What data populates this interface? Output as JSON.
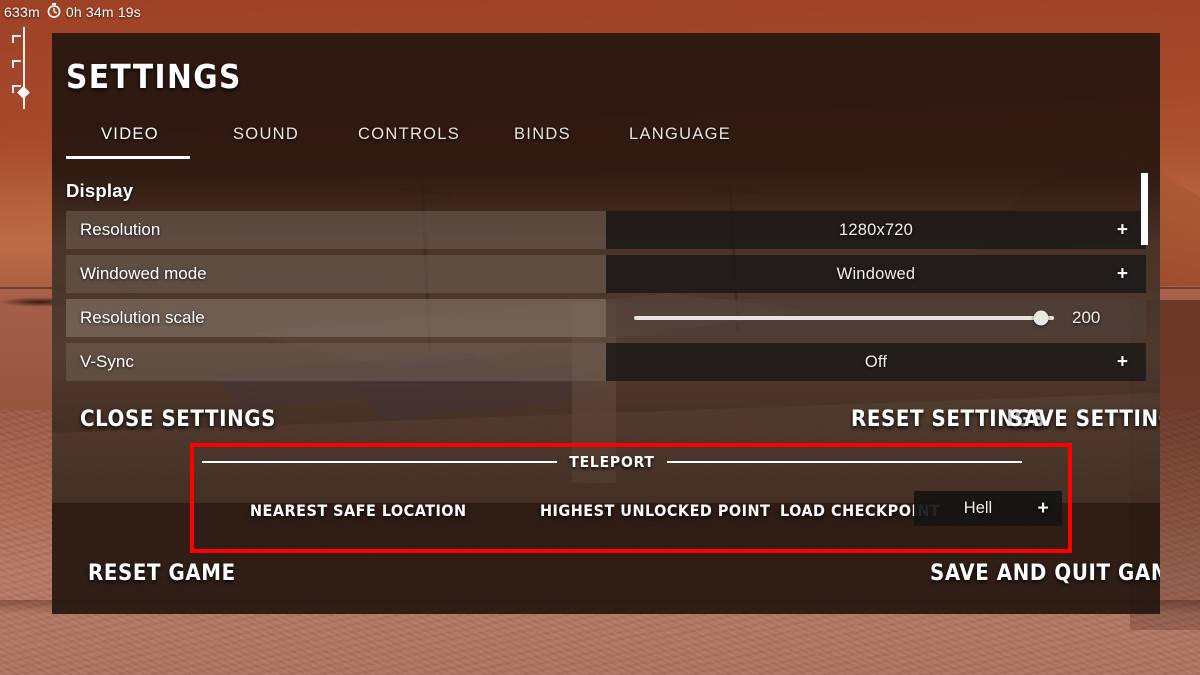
{
  "hud": {
    "distance": "633m",
    "timer_icon": "stopwatch-icon",
    "time": "0h 34m 19s"
  },
  "panel": {
    "title": "SETTINGS"
  },
  "tabs": [
    {
      "label": "VIDEO",
      "active": true
    },
    {
      "label": "SOUND",
      "active": false
    },
    {
      "label": "CONTROLS",
      "active": false
    },
    {
      "label": "BINDS",
      "active": false
    },
    {
      "label": "LANGUAGE",
      "active": false
    }
  ],
  "section": {
    "heading": "Display",
    "rows": [
      {
        "label": "Resolution",
        "type": "dropdown",
        "value": "1280x720",
        "increment": "+"
      },
      {
        "label": "Windowed mode",
        "type": "dropdown",
        "value": "Windowed",
        "increment": "+"
      },
      {
        "label": "Resolution scale",
        "type": "slider",
        "value": "200",
        "min": 0,
        "max": 200,
        "percent": 97
      },
      {
        "label": "V-Sync",
        "type": "dropdown",
        "value": "Off",
        "increment": "+"
      }
    ]
  },
  "actions": {
    "close_settings": "CLOSE SETTINGS",
    "reset_settings": "RESET SETTINGS",
    "save_settings": "SAVE SETTINGS",
    "reset_game": "RESET GAME",
    "save_and_quit": "SAVE AND QUIT GAME"
  },
  "teleport": {
    "title": "TELEPORT",
    "buttons": [
      {
        "label": "NEAREST SAFE LOCATION"
      },
      {
        "label": "HIGHEST UNLOCKED POINT"
      },
      {
        "label": "LOAD CHECKPOINT"
      }
    ],
    "destination": {
      "value": "Hell",
      "increment": "+"
    }
  },
  "annotation": {
    "color": "#ff0000",
    "shape": "rectangle"
  },
  "colors": {
    "panel_background": "#22150e",
    "row_label_background": "#706158",
    "row_value_background": "#1a1817",
    "accent_white": "#ffffff",
    "annotation_red": "#ff0000",
    "sky": "#a6492b",
    "ground": "#b87a66"
  }
}
